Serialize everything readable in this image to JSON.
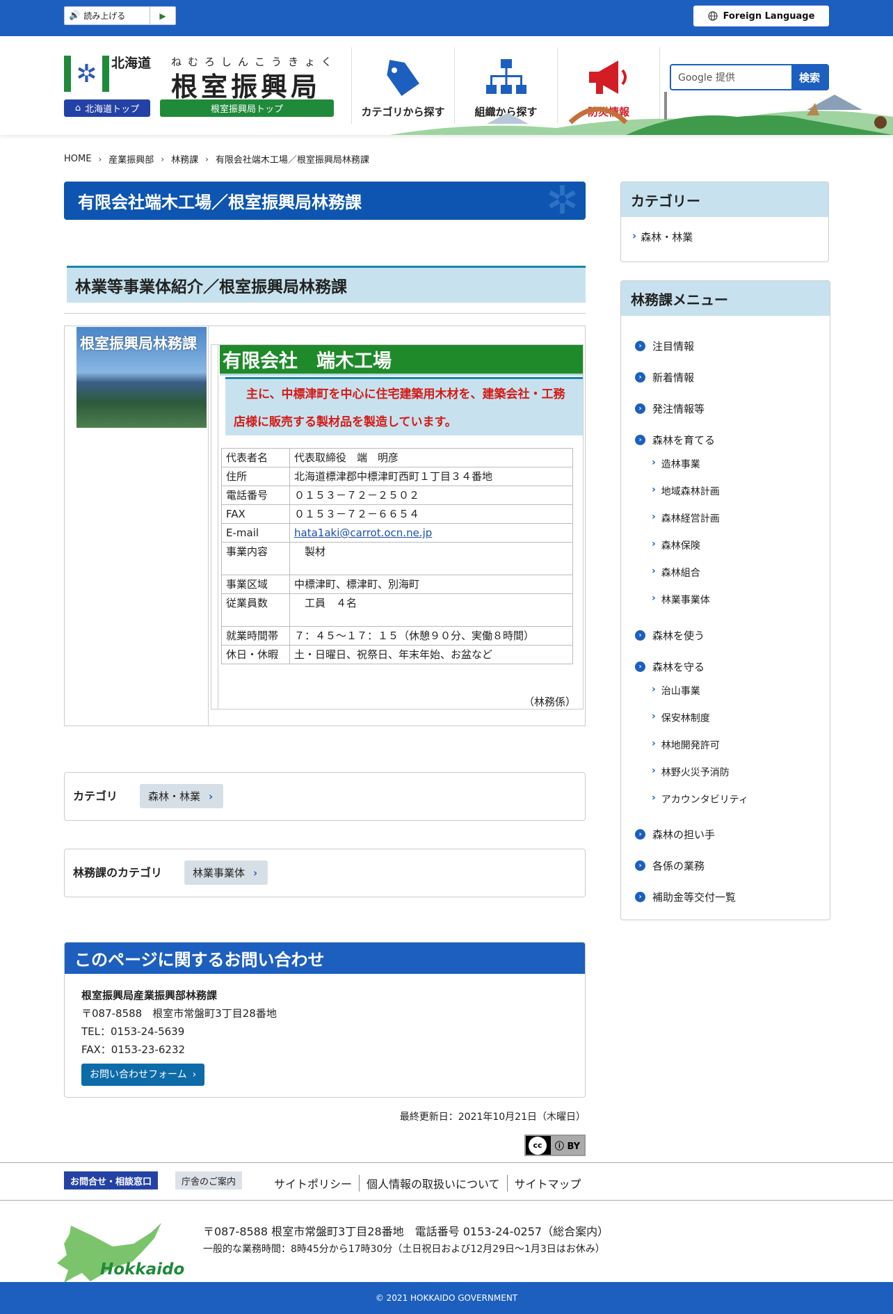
{
  "topbar": {
    "readaloud_label": "読み上げる",
    "foreign_language": "Foreign Language"
  },
  "header": {
    "pref_name": "北海道",
    "bureau_ruby": "ねむろしんこうきょく",
    "bureau_name": "根室振興局",
    "dotop_label": "北海道トップ",
    "kyokutop_label": "根室振興局トップ",
    "nav": [
      {
        "label": "カテゴリから探す",
        "icon": "tag-icon"
      },
      {
        "label": "組織から探す",
        "icon": "org-chart-icon"
      },
      {
        "label": "防災情報",
        "icon": "megaphone-icon"
      }
    ],
    "search_placeholder": "Google 提供",
    "search_button": "検索"
  },
  "breadcrumb": [
    "HOME",
    "産業振興部",
    "林務課",
    "有限会社端木工場／根室振興局林務課"
  ],
  "main": {
    "page_title": "有限会社端木工場／根室振興局林務課",
    "sub_title": "林業等事業体紹介／根室振興局林務課",
    "photo_label": "根室振興局林務課",
    "company_name": "有限会社　端木工場",
    "description": "主に、中標津町を中心に住宅建築用木材を、建築会社・工務店様に販売する製材品を製造しています。",
    "info_rows": [
      {
        "key": "代表者名",
        "value": "代表取締役　端　明彦"
      },
      {
        "key": "住所",
        "value": "北海道標津郡中標津町西町１丁目３４番地"
      },
      {
        "key": "電話番号",
        "value": "０１５３－７２－２５０２"
      },
      {
        "key": "FAX",
        "value": "０１５３－７２－６６５４"
      },
      {
        "key": "E-mail",
        "value": "hata1aki@carrot.ocn.ne.jp"
      },
      {
        "key": "事業内容",
        "value": "　製材"
      },
      {
        "key": "事業区域",
        "value": "中標津町、標津町、別海町"
      },
      {
        "key": "従業員数",
        "value": "　工員　４名"
      },
      {
        "key": "就業時間帯",
        "value": "７：４５～１７：１５（休憩９０分、実働８時間）"
      },
      {
        "key": "休日・休暇",
        "value": "土・日曜日、祝祭日、年末年始、お盆など"
      }
    ],
    "signature": "（林務係）",
    "category_label": "カテゴリ",
    "category_chip": "森林・林業",
    "section_category_label": "林務課のカテゴリ",
    "section_category_chip": "林業事業体"
  },
  "contact": {
    "heading": "このページに関するお問い合わせ",
    "org": "根室振興局産業振興部林務課",
    "address": "〒087-8588　根室市常盤町3丁目28番地",
    "tel": "TEL：0153-24-5639",
    "fax": "FAX：0153-23-6232",
    "form_button": "お問い合わせフォーム"
  },
  "updated": "最終更新日：2021年10月21日（木曜日）",
  "sidebar": {
    "category_head": "カテゴリー",
    "category_item": "森林・林業",
    "menu_head": "林務課メニュー",
    "menu": {
      "m1": "注目情報",
      "m2": "新着情報",
      "m3": "発注情報等",
      "m4": "森林を育てる",
      "s4": [
        "造林事業",
        "地域森林計画",
        "森林経営計画",
        "森林保険",
        "森林組合",
        "林業事業体"
      ],
      "m5": "森林を使う",
      "m6": "森林を守る",
      "s6": [
        "治山事業",
        "保安林制度",
        "林地開発許可",
        "林野火災予消防",
        "アカウンタビリティ"
      ],
      "m7": "森林の担い手",
      "m8": "各係の業務",
      "m9": "補助金等交付一覧"
    }
  },
  "footer": {
    "btn_contact": "お問合せ・相談窓口",
    "btn_office": "庁舎のご案内",
    "links": [
      "サイトポリシー",
      "個人情報の取扱いについて",
      "サイトマップ"
    ],
    "logo_text": "Hokkaido",
    "address_line": "〒087-8588 根室市常盤町3丁目28番地　電話番号 0153-24-0257（総合案内）",
    "hours_line": "一般的な業務時間：8時45分から17時30分（土日祝日および12月29日～1月3日はお休み）",
    "copyright": "© 2021 HOKKAIDO GOVERNMENT"
  },
  "colors": {
    "brand_blue": "#1d5fbf",
    "brand_green": "#1f8a3a",
    "accent_red": "#d31b17",
    "light_blue": "#c7e2ee"
  }
}
